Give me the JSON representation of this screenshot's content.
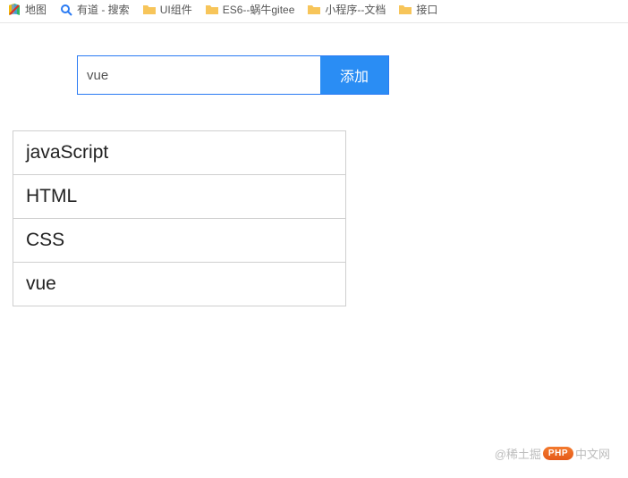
{
  "bookmarks": [
    {
      "type": "maps",
      "label": "地图"
    },
    {
      "type": "search",
      "label": "有道 - 搜索"
    },
    {
      "type": "folder",
      "label": "UI组件"
    },
    {
      "type": "folder",
      "label": "ES6--蜗牛gitee"
    },
    {
      "type": "folder",
      "label": "小程序--文档"
    },
    {
      "type": "folder",
      "label": "接口"
    }
  ],
  "input": {
    "value": "vue",
    "placeholder": ""
  },
  "add_button_label": "添加",
  "items": [
    "javaScript",
    "HTML",
    "CSS",
    "vue"
  ],
  "watermark": {
    "prefix": "@稀土掘",
    "badge": "PHP",
    "suffix": "中文网"
  }
}
